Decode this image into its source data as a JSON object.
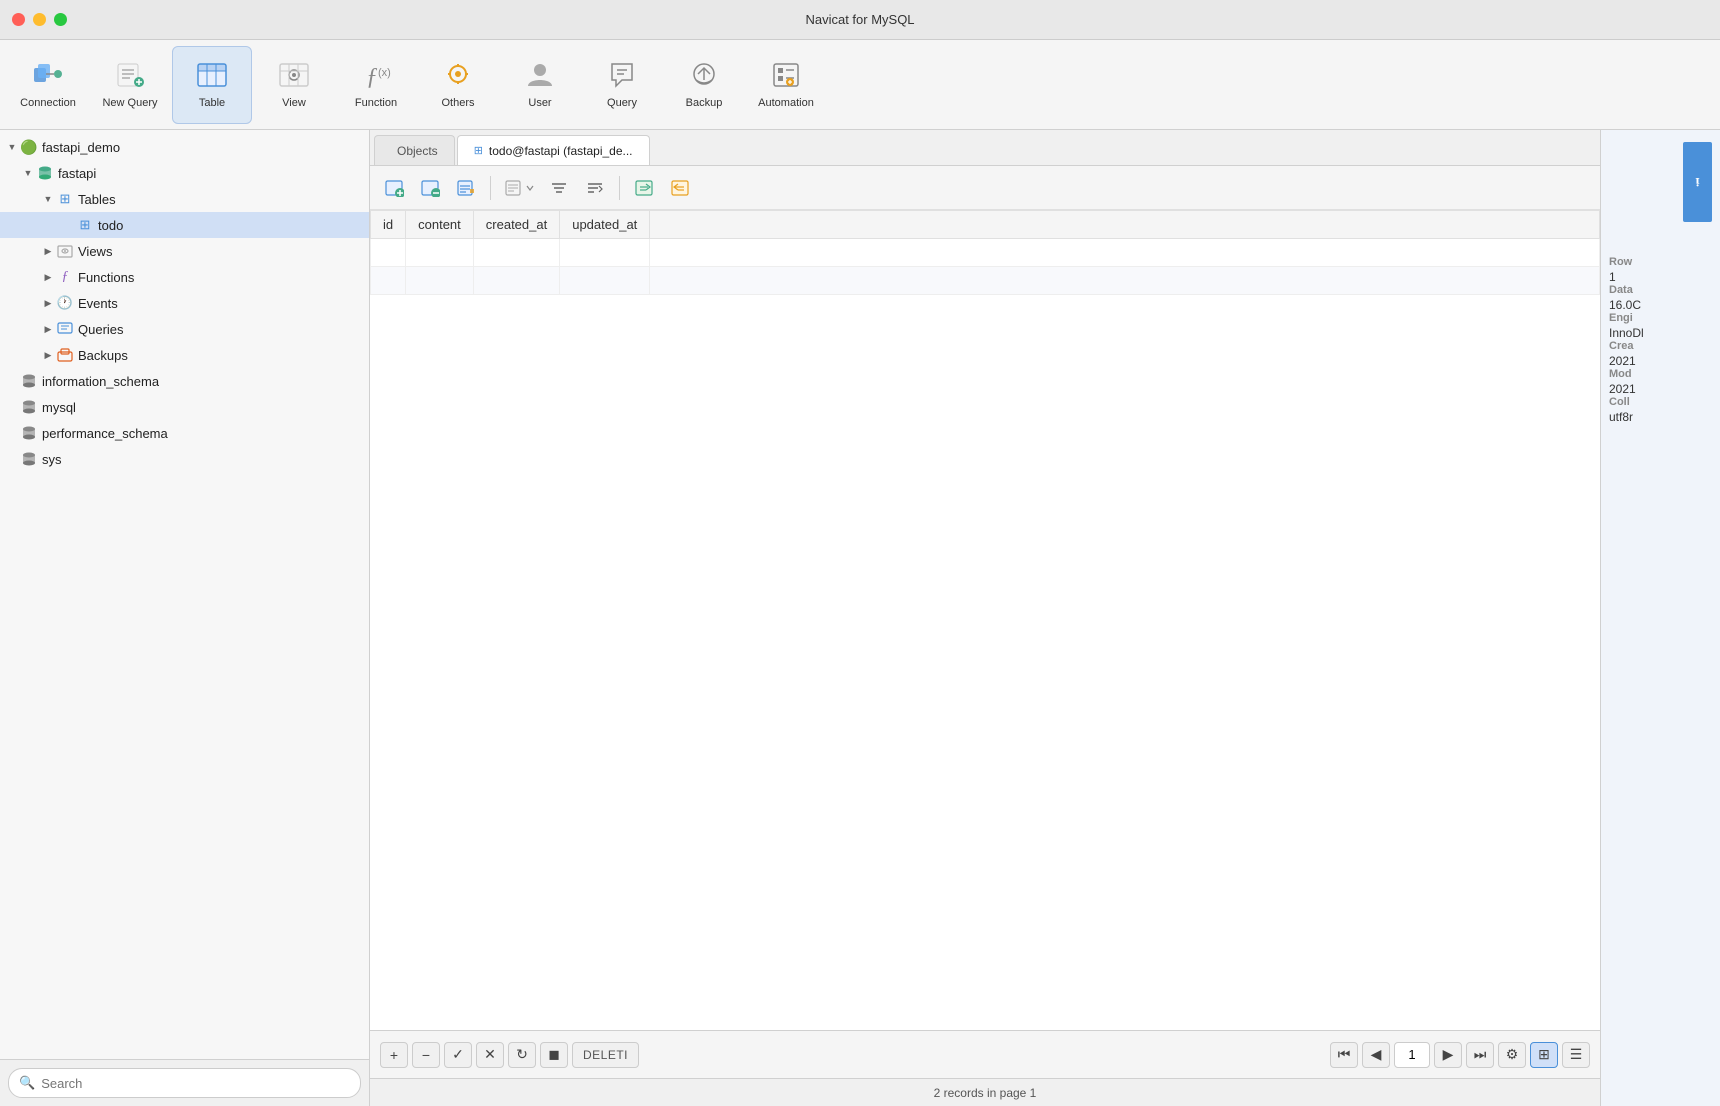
{
  "app": {
    "title": "Navicat for MySQL"
  },
  "toolbar": {
    "items": [
      {
        "id": "connection",
        "label": "Connection",
        "icon": "🔌"
      },
      {
        "id": "new-query",
        "label": "New Query",
        "icon": "📝"
      },
      {
        "id": "table",
        "label": "Table",
        "icon": "⊞"
      },
      {
        "id": "view",
        "label": "View",
        "icon": "👁"
      },
      {
        "id": "function",
        "label": "Function",
        "icon": "ƒ"
      },
      {
        "id": "others",
        "label": "Others",
        "icon": "⚙"
      },
      {
        "id": "user",
        "label": "User",
        "icon": "👤"
      },
      {
        "id": "query",
        "label": "Query",
        "icon": "⬡"
      },
      {
        "id": "backup",
        "label": "Backup",
        "icon": "↩"
      },
      {
        "id": "automation",
        "label": "Automation",
        "icon": "☑"
      }
    ]
  },
  "sidebar": {
    "databases": [
      {
        "id": "fastapi_demo",
        "label": "fastapi_demo",
        "icon": "🟢",
        "expanded": true,
        "children": [
          {
            "id": "fastapi",
            "label": "fastapi",
            "icon": "🗄",
            "expanded": true,
            "children": [
              {
                "id": "tables",
                "label": "Tables",
                "icon": "⊞",
                "expanded": true,
                "children": [
                  {
                    "id": "todo",
                    "label": "todo",
                    "icon": "⊞",
                    "selected": true
                  }
                ]
              },
              {
                "id": "views",
                "label": "Views",
                "icon": "👁",
                "expanded": false
              },
              {
                "id": "functions",
                "label": "Functions",
                "icon": "ƒ",
                "expanded": false
              },
              {
                "id": "events",
                "label": "Events",
                "icon": "🕐",
                "expanded": false
              },
              {
                "id": "queries",
                "label": "Queries",
                "icon": "⊟",
                "expanded": false
              },
              {
                "id": "backups",
                "label": "Backups",
                "icon": "💾",
                "expanded": false
              }
            ]
          }
        ]
      },
      {
        "id": "information_schema",
        "label": "information_schema",
        "icon": "🗄"
      },
      {
        "id": "mysql",
        "label": "mysql",
        "icon": "🗄"
      },
      {
        "id": "performance_schema",
        "label": "performance_schema",
        "icon": "🗄"
      },
      {
        "id": "sys",
        "label": "sys",
        "icon": "🗄"
      }
    ],
    "search_placeholder": "Search"
  },
  "tabs": [
    {
      "id": "objects",
      "label": "Objects",
      "icon": "",
      "active": false
    },
    {
      "id": "todo-tab",
      "label": "todo@fastapi (fastapi_de...",
      "icon": "⊞",
      "active": true
    }
  ],
  "table": {
    "columns": [
      "id",
      "content",
      "created_at",
      "updated_at"
    ],
    "rows": []
  },
  "bottom_bar": {
    "add": "+",
    "remove": "−",
    "check": "✓",
    "cancel": "✕",
    "refresh": "↻",
    "stop": "◼",
    "delete_label": "DELETI",
    "page_current": "1",
    "status": "2 records in page 1"
  },
  "right_panel": {
    "items": [
      {
        "label": "Row",
        "value": "1"
      },
      {
        "label": "Data",
        "value": "16.0C"
      },
      {
        "label": "Engi",
        "value": "InnoDl"
      },
      {
        "label": "Crea",
        "value": "2021"
      },
      {
        "label": "Mod",
        "value": "2021"
      },
      {
        "label": "Coll",
        "value": "utf8r"
      }
    ]
  }
}
